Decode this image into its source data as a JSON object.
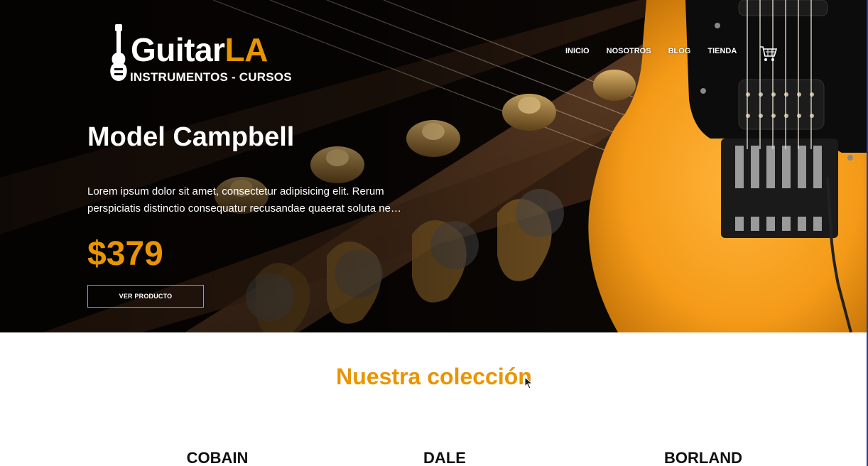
{
  "brand": {
    "name_main": "Guitar",
    "name_accent": "LA",
    "tagline": "INSTRUMENTOS - CURSOS",
    "accent_color": "#e99401"
  },
  "nav": {
    "items": [
      {
        "label": "INICIO"
      },
      {
        "label": "NOSOTROS"
      },
      {
        "label": "BLOG"
      },
      {
        "label": "TIENDA"
      }
    ],
    "cart_icon": "shopping-cart-icon"
  },
  "hero": {
    "title": "Model Campbell",
    "description": "Lorem ipsum dolor sit amet, consectetur adipisicing elit. Rerum perspiciatis distinctio consequatur recusandae quaerat soluta ne…",
    "price": "$379",
    "button_label": "VER PRODUCTO"
  },
  "collection": {
    "title": "Nuestra colección",
    "products": [
      {
        "name": "COBAIN"
      },
      {
        "name": "DALE"
      },
      {
        "name": "BORLAND"
      }
    ]
  }
}
